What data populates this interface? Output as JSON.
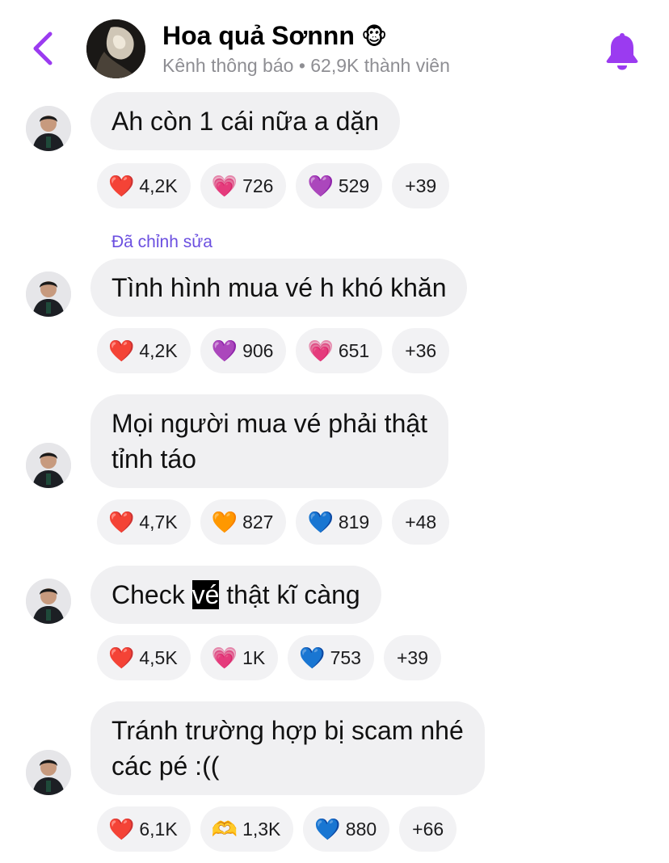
{
  "header": {
    "back_icon": "chevron-left-icon",
    "title": "Hoa quả Sơnnn",
    "title_emoji": "🐵",
    "subtitle": "Kênh thông báo • 62,9K thành viên",
    "bell_icon": "bell-icon",
    "accent_color": "#9b3bf0"
  },
  "messages": [
    {
      "edited_label": "",
      "lines": [
        "Ah còn 1 cái nữa a dặn"
      ],
      "reactions": [
        {
          "emoji": "❤️",
          "count": "4,2K"
        },
        {
          "emoji": "💗",
          "count": "726"
        },
        {
          "emoji": "💜",
          "count": "529"
        }
      ],
      "more": "+39"
    },
    {
      "edited_label": "Đã chỉnh sửa",
      "lines": [
        "Tình hình mua vé h khó khăn"
      ],
      "reactions": [
        {
          "emoji": "❤️",
          "count": "4,2K"
        },
        {
          "emoji": "💜",
          "count": "906"
        },
        {
          "emoji": "💗",
          "count": "651"
        }
      ],
      "more": "+36"
    },
    {
      "edited_label": "",
      "lines": [
        "Mọi người mua vé phải thật",
        "tỉnh táo"
      ],
      "reactions": [
        {
          "emoji": "❤️",
          "count": "4,7K"
        },
        {
          "emoji": "🧡",
          "count": "827"
        },
        {
          "emoji": "💙",
          "count": "819"
        }
      ],
      "more": "+48"
    },
    {
      "edited_label": "",
      "text_before": "Check ",
      "text_highlight": "vé",
      "text_after": " thật kĩ càng",
      "reactions": [
        {
          "emoji": "❤️",
          "count": "4,5K"
        },
        {
          "emoji": "💗",
          "count": "1K"
        },
        {
          "emoji": "💙",
          "count": "753"
        }
      ],
      "more": "+39"
    },
    {
      "edited_label": "",
      "lines": [
        "Tránh trường hợp bị scam nhé",
        "các pé :(("
      ],
      "reactions": [
        {
          "emoji": "❤️",
          "count": "6,1K"
        },
        {
          "emoji": "🫶",
          "count": "1,3K"
        },
        {
          "emoji": "💙",
          "count": "880"
        }
      ],
      "more": "+66"
    }
  ]
}
